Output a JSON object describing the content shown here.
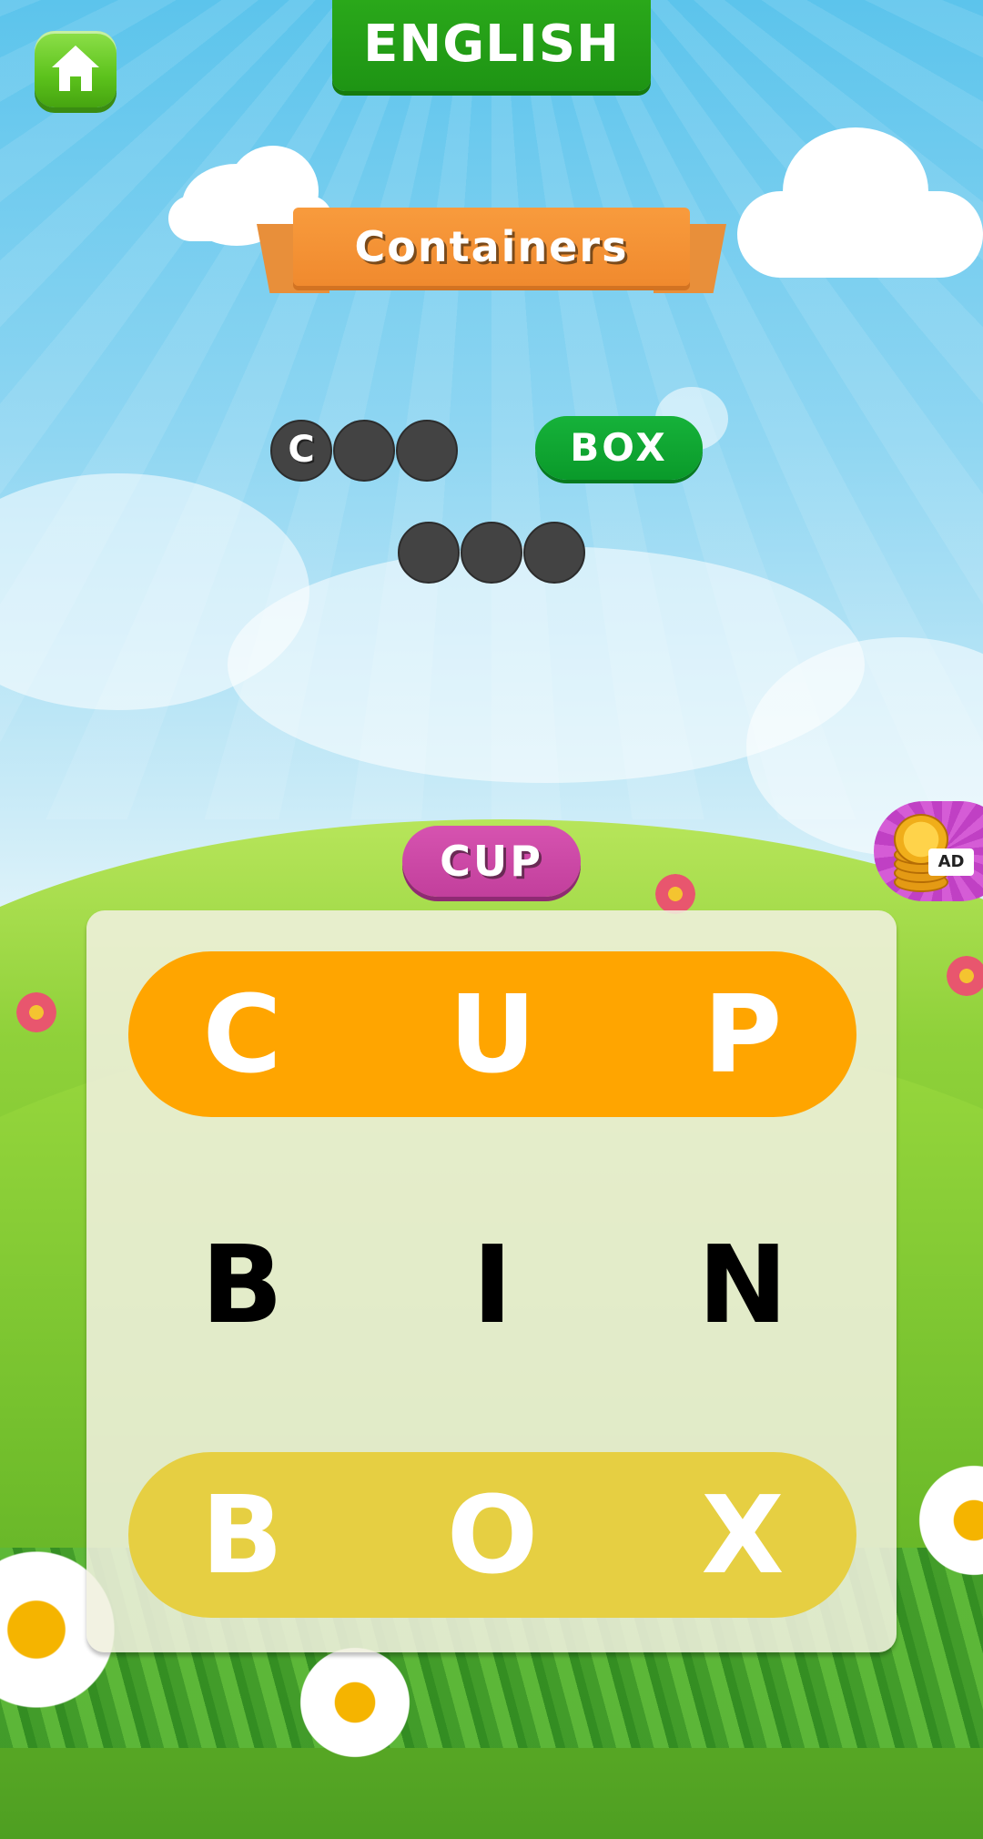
{
  "header": {
    "home_icon": "home-icon",
    "language": "ENGLISH"
  },
  "category": {
    "title": "Containers"
  },
  "answers": [
    {
      "letters": [
        "C",
        "",
        ""
      ],
      "revealed": 1,
      "length": 3,
      "status": "hinted"
    },
    {
      "word": "BOX",
      "status": "found",
      "color": "#0fa832"
    },
    {
      "letters": [
        "",
        "",
        ""
      ],
      "revealed": 0,
      "length": 3,
      "status": "hidden"
    }
  ],
  "current_word": {
    "text": "CUP",
    "color": "#c94aa5"
  },
  "ad_button": {
    "icon": "coins-stack-icon",
    "label": "AD"
  },
  "board": {
    "rows": [
      {
        "letters": [
          "C",
          "U",
          "P"
        ],
        "highlight": "found",
        "color": "#ffa500"
      },
      {
        "letters": [
          "B",
          "I",
          "N"
        ],
        "highlight": "none"
      },
      {
        "letters": [
          "B",
          "O",
          "X"
        ],
        "highlight": "found",
        "color": "#e6cf42"
      }
    ]
  }
}
